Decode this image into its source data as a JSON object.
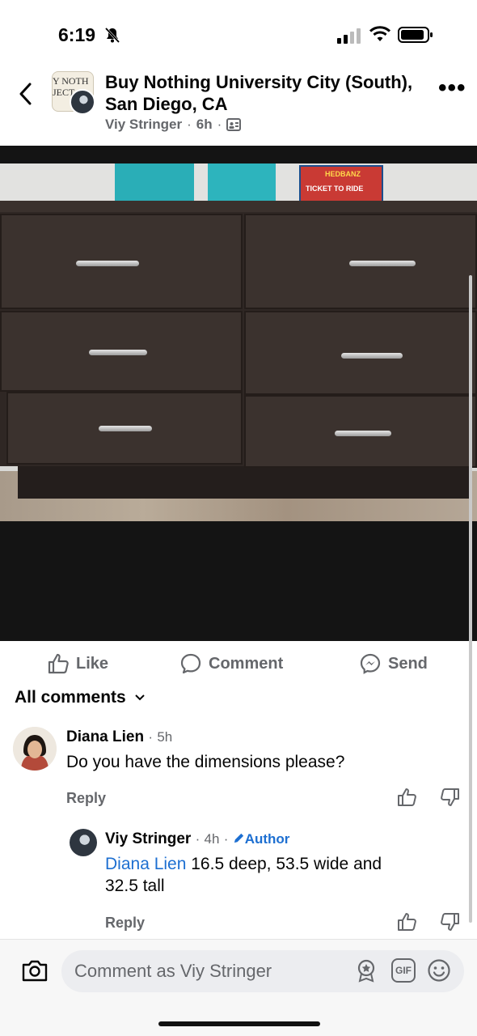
{
  "status_bar": {
    "time": "6:19",
    "icons": [
      "bell-off-icon",
      "signal-icon",
      "wifi-icon",
      "battery-icon"
    ]
  },
  "post": {
    "group_logo_text": [
      "Y NOTH",
      "JECT"
    ],
    "group_name": "Buy Nothing University City (South), San Diego, CA",
    "author": "Viy Stringer",
    "time": "6h",
    "separator": "·",
    "privacy_icon": "members-only-icon"
  },
  "photo": {
    "alt_text": "",
    "box_text": [
      "HEDBANZ",
      "TICKET TO RIDE"
    ]
  },
  "actions": {
    "like": "Like",
    "comment": "Comment",
    "send": "Send"
  },
  "comments_header": "All comments",
  "comments": [
    {
      "name": "Diana Lien",
      "time": "5h",
      "text": "Do you have the dimensions please?",
      "reply": "Reply"
    },
    {
      "name": "Viy Stringer",
      "time": "4h",
      "badge": "Author",
      "mention": "Diana Lien",
      "text_line1": "16.5 deep, 53.5 wide and",
      "text_line2": "32.5 tall",
      "reply": "Reply"
    }
  ],
  "composer": {
    "placeholder": "Comment as Viy Stringer",
    "gif_label": "GIF"
  },
  "colors": {
    "accent_blue": "#1d6fd1",
    "secondary_text": "#65676b"
  }
}
